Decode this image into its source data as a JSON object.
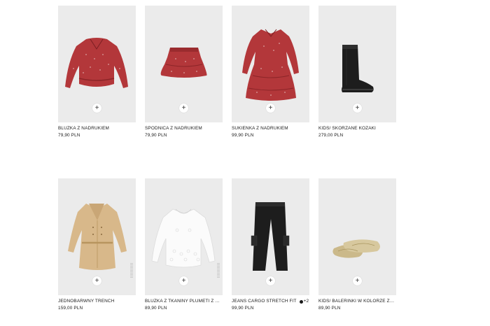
{
  "products": [
    {
      "name": "BLUZKA Z NADRUKIEM",
      "price": "79,90 PLN",
      "add_icon": "plus-icon"
    },
    {
      "name": "SPÓDNICA Z NADRUKIEM",
      "price": "79,90 PLN",
      "add_icon": "plus-icon"
    },
    {
      "name": "SUKIENKA Z NADRUKIEM",
      "price": "99,90 PLN",
      "add_icon": "plus-icon"
    },
    {
      "name": "KIDS/ SKÓRZANE KOZAKI",
      "price": "279,00 PLN",
      "add_icon": "plus-icon"
    },
    {
      "name": "JEDNOBARWNY TRENCH",
      "price": "159,00 PLN",
      "add_icon": "plus-icon"
    },
    {
      "name": "BLUZKA Z TKANINY PLUMETI Z HAFTEM",
      "price": "89,90 PLN",
      "add_icon": "plus-icon"
    },
    {
      "name": "JEANS CARGO STRETCH FIT",
      "price": "99,90 PLN",
      "colors_more": "+2",
      "add_icon": "plus-icon"
    },
    {
      "name": "KIDS/ BALERINKI W KOLORZE ZŁOTA",
      "price": "89,90 PLN",
      "add_icon": "plus-icon"
    }
  ],
  "plus_symbol": "+",
  "colors": {
    "photo_bg": "#ebebeb",
    "red_print": "#b3373a",
    "trench": "#d8b88a",
    "black": "#1d1d1d",
    "gold": "#cbb98a"
  }
}
